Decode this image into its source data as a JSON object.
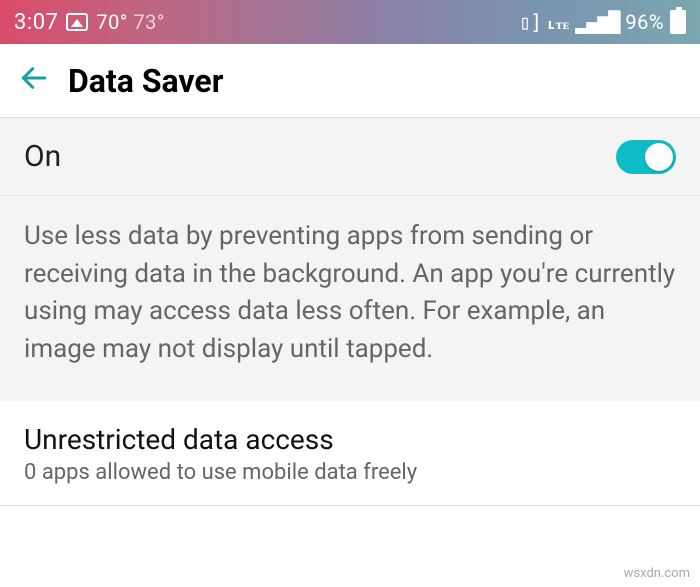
{
  "status": {
    "time": "3:07",
    "temp1": "70°",
    "temp2": "73°",
    "network": "4G",
    "battery_pct": "96%"
  },
  "header": {
    "title": "Data Saver"
  },
  "toggle": {
    "label": "On"
  },
  "description": "Use less data by preventing apps from sending or receiving data in the background. An app you're currently using may access data less often. For example, an image may not display until tapped.",
  "unrestricted": {
    "title": "Unrestricted data access",
    "subtitle": "0 apps allowed to use mobile data freely"
  },
  "watermark": "wsxdn.com"
}
